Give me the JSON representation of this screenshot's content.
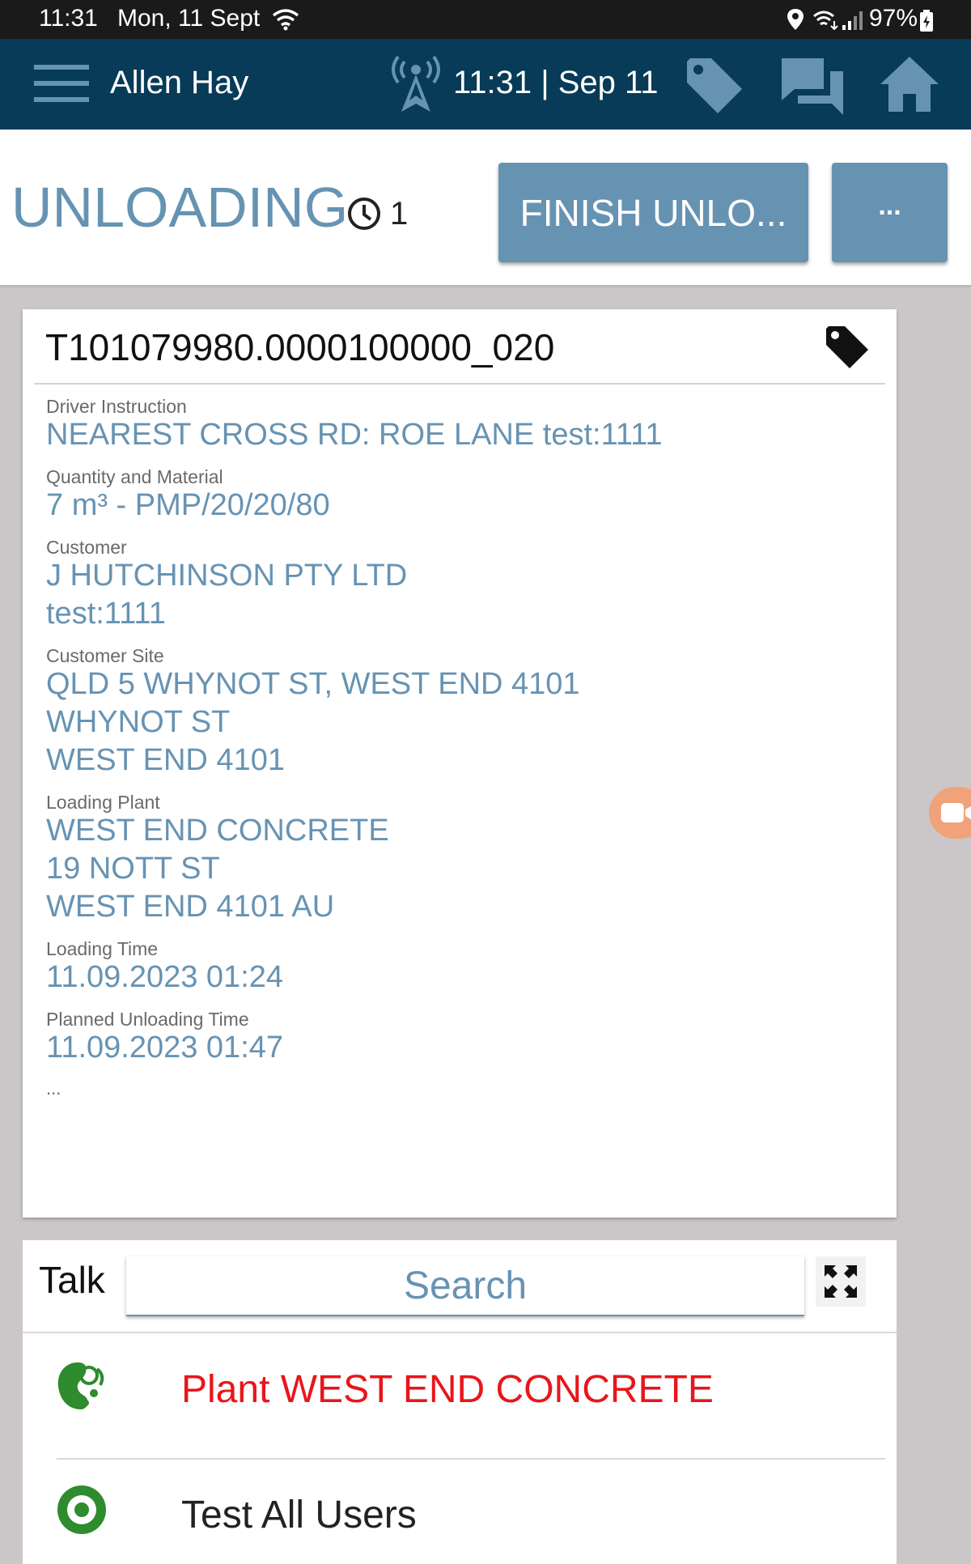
{
  "status_bar": {
    "time": "11:31",
    "date": "Mon, 11 Sept",
    "battery": "97%",
    "icons": [
      "wifi-icon",
      "location-icon",
      "wifi-call-icon",
      "signal-icon",
      "battery-charging-icon"
    ]
  },
  "app_bar": {
    "user_name": "Allen Hay",
    "clock": "11:31 | Sep 11",
    "icons": [
      "menu-icon",
      "radio-tower-icon",
      "tag-icon",
      "chat-icon",
      "home-icon"
    ]
  },
  "header": {
    "title": "UNLOADING",
    "timer_count": "1",
    "finish_button": "FINISH UNLO...",
    "more_button": "..."
  },
  "ticket": {
    "id": "T101079980.0000100000_020",
    "fields": [
      {
        "label": "Driver Instruction",
        "lines": [
          "NEAREST CROSS RD: ROE LANE test:1111"
        ]
      },
      {
        "label": "Quantity and Material",
        "lines": [
          "7 m³ - PMP/20/20/80"
        ]
      },
      {
        "label": "Customer",
        "lines": [
          "J HUTCHINSON PTY LTD",
          "test:1111"
        ]
      },
      {
        "label": "Customer Site",
        "lines": [
          "QLD 5 WHYNOT ST, WEST END 4101",
          "WHYNOT ST",
          "WEST END 4101"
        ]
      },
      {
        "label": "Loading Plant",
        "lines": [
          "WEST END CONCRETE",
          "19 NOTT ST",
          "WEST END 4101 AU"
        ]
      },
      {
        "label": "Loading Time",
        "lines": [
          "11.09.2023 01:24"
        ]
      },
      {
        "label": "Planned Unloading Time",
        "lines": [
          "11.09.2023 01:47"
        ]
      }
    ],
    "ellipsis": "..."
  },
  "talk": {
    "title": "Talk",
    "search_placeholder": "Search",
    "contacts": [
      {
        "name": "Plant WEST END CONCRETE",
        "color": "#e8161b",
        "icon": "plant-headset-icon"
      },
      {
        "name": "Test All Users",
        "color": "#222222",
        "icon": "group-target-icon"
      }
    ]
  },
  "colors": {
    "app_bar": "#073b57",
    "accent": "#6793b3",
    "alert_text": "#e8161b",
    "icon_green": "#2e8b2e",
    "floating_button": "#f0a37a"
  }
}
